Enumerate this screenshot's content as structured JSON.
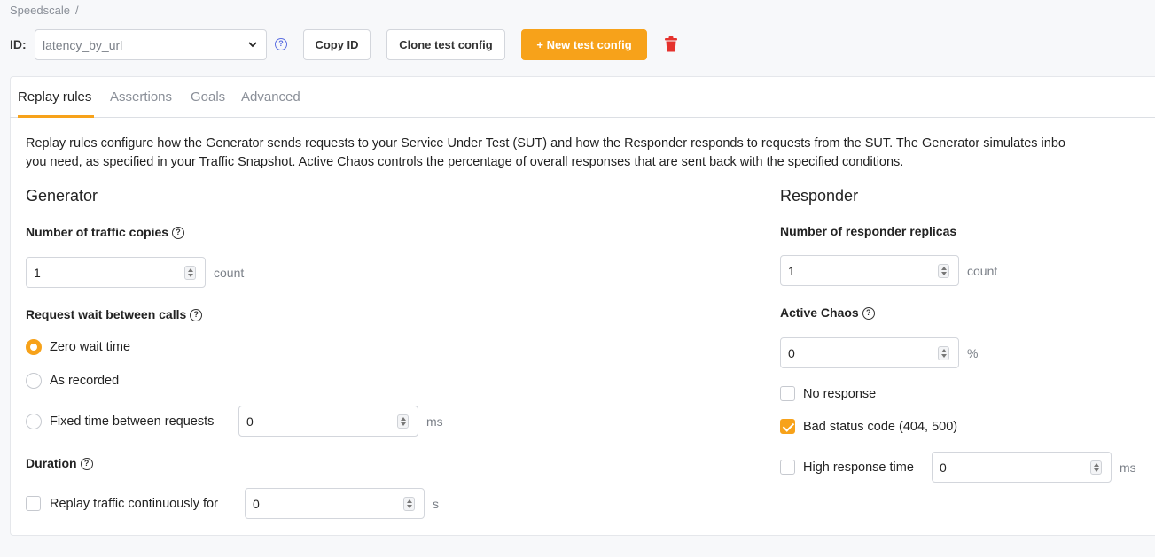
{
  "breadcrumb": {
    "root": "Speedscale",
    "separator": "/"
  },
  "header": {
    "id_label": "ID:",
    "id_value": "latency_by_url",
    "copy_id": "Copy ID",
    "clone": "Clone test config",
    "new_config": "+ New test config"
  },
  "tabs": [
    "Replay rules",
    "Assertions",
    "Goals",
    "Advanced"
  ],
  "description": {
    "line1": "Replay rules configure how the Generator sends requests to your Service Under Test (SUT) and how the Responder responds to requests from the SUT. The Generator simulates inbo",
    "line2": "you need, as specified in your Traffic Snapshot. Active Chaos controls the percentage of overall responses that are sent back with the specified conditions."
  },
  "generator": {
    "title": "Generator",
    "copies_label": "Number of traffic copies",
    "copies_value": "1",
    "copies_unit": "count",
    "wait_label": "Request wait between calls",
    "wait_options": [
      "Zero wait time",
      "As recorded",
      "Fixed time between requests"
    ],
    "wait_selected": "Zero wait time",
    "fixed_value": "0",
    "fixed_unit": "ms",
    "duration_label": "Duration",
    "duration_option": "Replay traffic continuously for",
    "duration_value": "0",
    "duration_unit": "s"
  },
  "responder": {
    "title": "Responder",
    "replicas_label": "Number of responder replicas",
    "replicas_value": "1",
    "replicas_unit": "count",
    "chaos_label": "Active Chaos",
    "chaos_value": "0",
    "chaos_unit": "%",
    "no_response": "No response",
    "bad_status": "Bad status code (404, 500)",
    "high_response": "High response time",
    "high_value": "0",
    "high_unit": "ms"
  },
  "colors": {
    "accent": "#f7a21a",
    "delete": "#e5322d"
  },
  "icons": [
    "chevron-down-icon",
    "help-icon",
    "trash-icon",
    "plus-icon",
    "spinner-icon"
  ]
}
